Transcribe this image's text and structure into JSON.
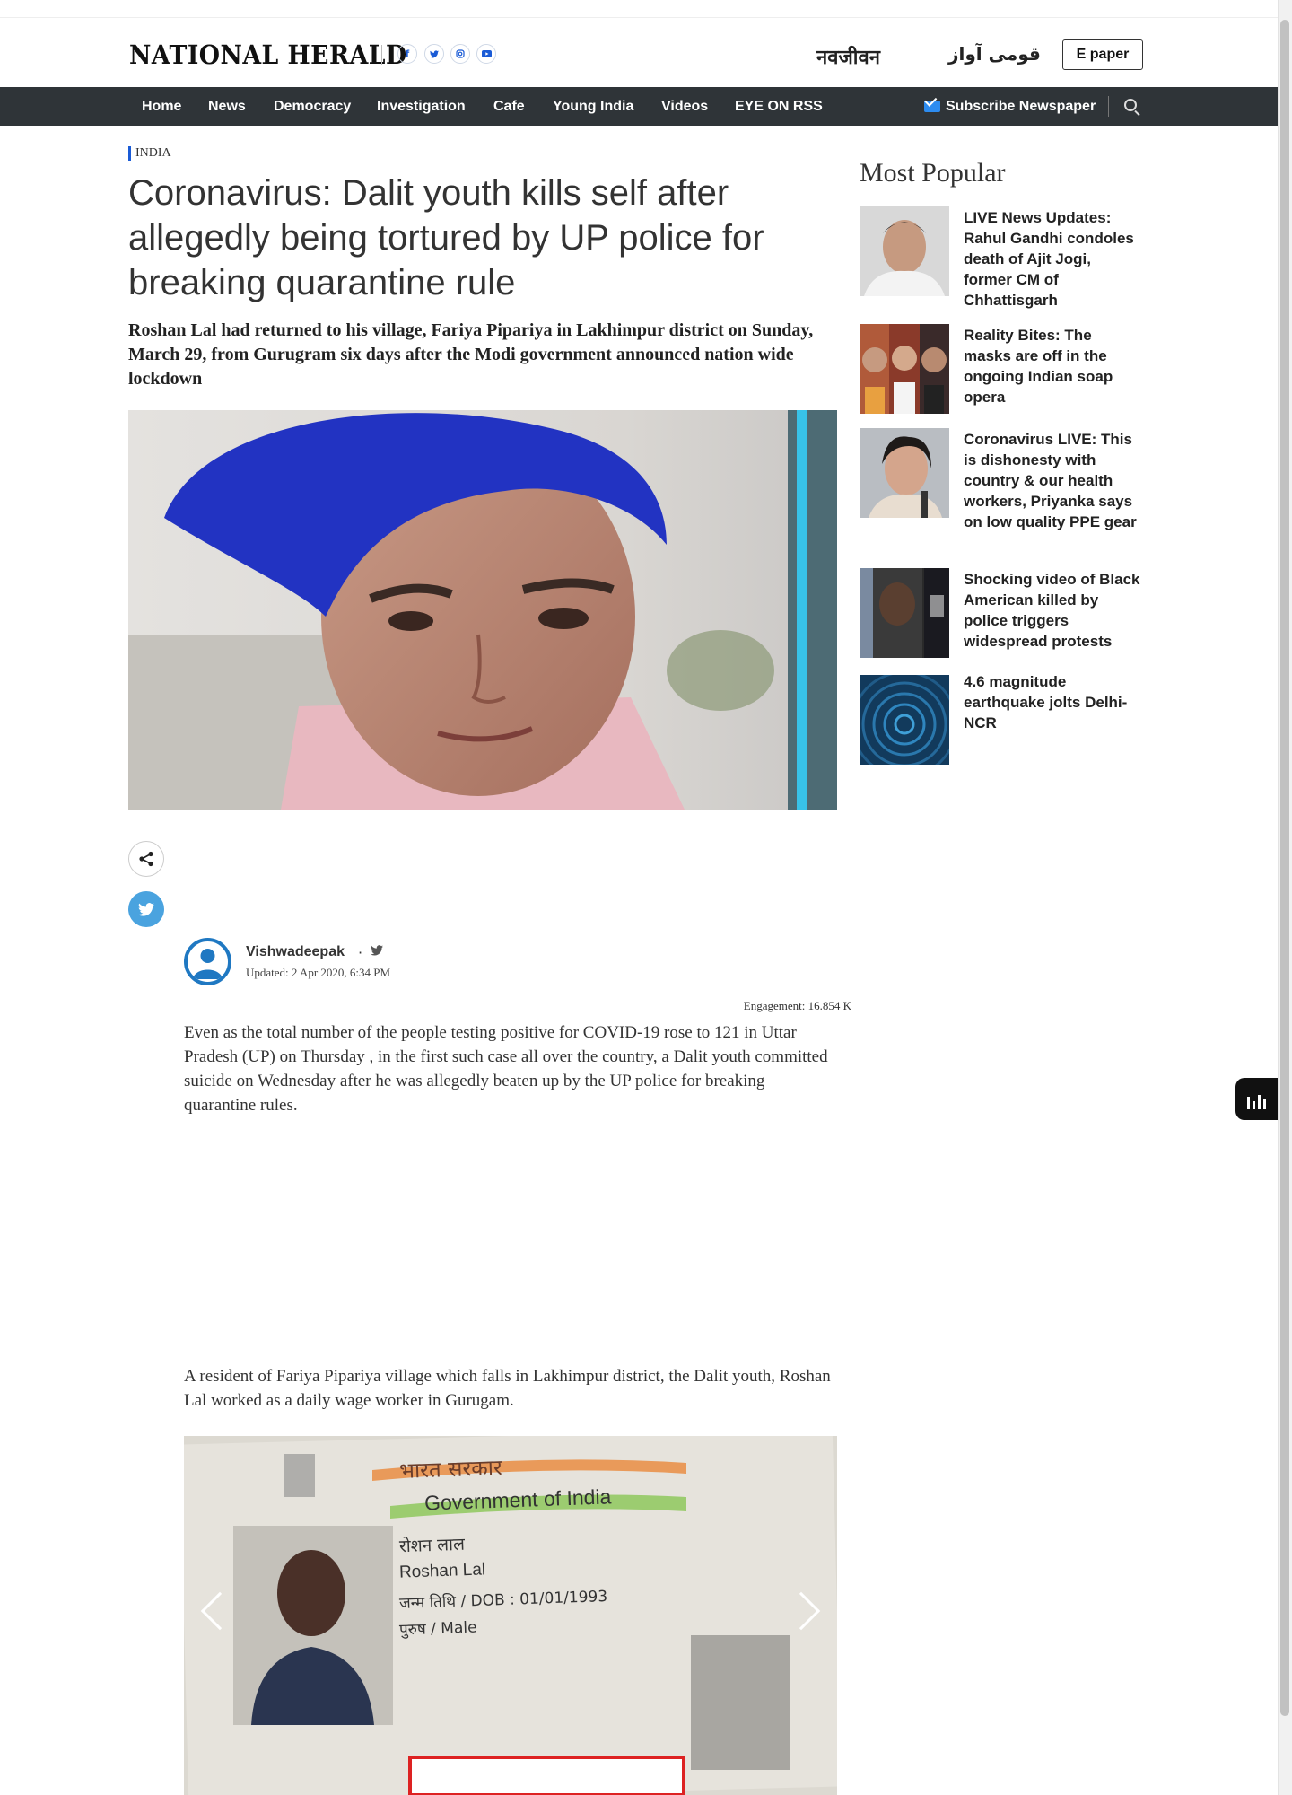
{
  "header": {
    "logo": "NATIONAL HERALD",
    "social": [
      "facebook-icon",
      "twitter-icon",
      "instagram-icon",
      "youtube-icon"
    ],
    "sister_sites": [
      "नवजीवन",
      "قومی آواز"
    ],
    "epaper_label": "E paper"
  },
  "nav": {
    "items": [
      "Home",
      "News",
      "Democracy",
      "Investigation",
      "Cafe",
      "Young India",
      "Videos",
      "EYE ON RSS"
    ],
    "subscribe_label": "Subscribe Newspaper"
  },
  "article": {
    "kicker": "INDIA",
    "headline": "Coronavirus: Dalit youth kills self after allegedly being tortured by UP police for breaking quarantine rule",
    "subhead": "Roshan Lal had returned to his village, Fariya Pipariya in Lakhimpur district on Sunday, March 29, from Gurugram six days after the Modi government announced nation wide lockdown",
    "author": "Vishwadeepak",
    "updated": "Updated: 2 Apr 2020, 6:34 PM",
    "engagement": "Engagement: 16.854 K",
    "paragraphs": [
      "Even as the total number of the people testing positive for COVID-19 rose to 121 in Uttar Pradesh (UP) on Thursday , in the first such case all over the country, a Dalit youth committed suicide on Wednesday after he was allegedly beaten up by the UP police for breaking quarantine rules.",
      "A resident of Fariya Pipariya village which falls in Lakhimpur district, the Dalit youth, Roshan Lal worked as a daily wage worker in Gurugam."
    ],
    "id_card": {
      "line1": "भारत सरकार",
      "line2": "Government of India",
      "name_hi": "रोशन लाल",
      "name_en": "Roshan Lal",
      "dob": "जन्म तिथि / DOB : 01/01/1993",
      "gender": "पुरुष / Male"
    }
  },
  "sidebar": {
    "title": "Most Popular",
    "items": [
      {
        "title": "LIVE News Updates: Rahul Gandhi condoles death of Ajit Jogi, former CM of Chhattisgarh"
      },
      {
        "title": "Reality Bites: The masks are off in the ongoing Indian soap opera"
      },
      {
        "title": "Coronavirus LIVE: This is dishonesty with country & our health workers, Priyanka says on low quality PPE gear"
      },
      {
        "title": "Shocking video of Black American killed by police triggers widespread protests"
      },
      {
        "title": "4.6 magnitude earthquake jolts Delhi-NCR"
      }
    ]
  },
  "colors": {
    "nav_bg": "#2f3438",
    "accent": "#1a5bd6",
    "twitter": "#4aa3df"
  }
}
